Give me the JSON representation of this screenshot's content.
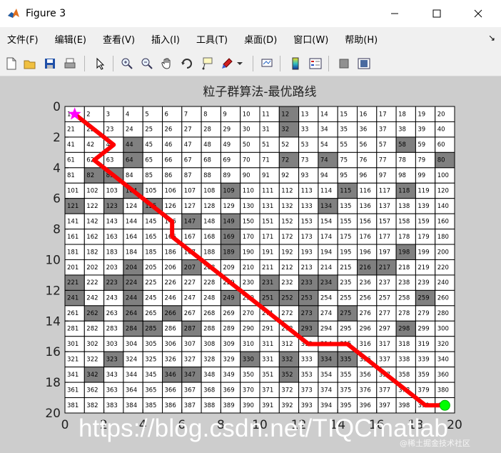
{
  "window": {
    "title": "Figure 3",
    "controls": [
      "minimize",
      "maximize",
      "close"
    ]
  },
  "menu": [
    "文件(F)",
    "编辑(E)",
    "查看(V)",
    "插入(I)",
    "工具(T)",
    "桌面(D)",
    "窗口(W)",
    "帮助(H)"
  ],
  "menu_overflow": "↘",
  "toolbar": [
    "new-figure-icon",
    "open-file-icon",
    "save-icon",
    "print-icon",
    "pointer-icon",
    "zoom-in-icon",
    "zoom-out-icon",
    "pan-hand-icon",
    "rotate-3d-icon",
    "data-cursor-icon",
    "brush-icon",
    "brush-dropdown-icon",
    "link-plot-icon",
    "colorbar-icon",
    "legend-icon",
    "hide-plot-tools-icon",
    "show-plot-tools-icon"
  ],
  "chart_data": {
    "type": "heatmap",
    "title": "粒子群算法-最优路线",
    "xlim": [
      0,
      20
    ],
    "ylim": [
      0,
      20
    ],
    "y_reversed": true,
    "xticks": [
      0,
      2,
      4,
      6,
      8,
      10,
      12,
      14,
      16,
      18,
      20
    ],
    "yticks": [
      0,
      2,
      4,
      6,
      8,
      10,
      12,
      14,
      16,
      18,
      20
    ],
    "grid_size": 20,
    "cell_labels": "sequential 1-400, row-major from top-left",
    "obstacle_cells": [
      12,
      32,
      44,
      58,
      64,
      72,
      74,
      80,
      82,
      83,
      104,
      109,
      115,
      118,
      121,
      123,
      125,
      134,
      147,
      149,
      169,
      189,
      198,
      204,
      207,
      216,
      217,
      221,
      223,
      224,
      231,
      233,
      234,
      241,
      244,
      249,
      251,
      252,
      253,
      259,
      262,
      264,
      266,
      273,
      275,
      284,
      285,
      287,
      293,
      298,
      323,
      330,
      332,
      334,
      335,
      342,
      346,
      347,
      352
    ],
    "path": {
      "x": [
        0.5,
        2.5,
        2.0,
        2.5,
        1.5,
        5.5,
        5.5,
        12.5,
        14.5,
        18.5,
        19.5
      ],
      "y": [
        0.5,
        2.5,
        3.0,
        2.5,
        3.5,
        7.5,
        8.5,
        15.5,
        15.5,
        19.5,
        19.5
      ],
      "color": "#ff0000"
    },
    "start": {
      "x": 0.5,
      "y": 0.5,
      "marker": "star",
      "color": "#ff00ff"
    },
    "goal": {
      "x": 19.5,
      "y": 19.5,
      "marker": "circle",
      "color": "#00ff00"
    },
    "obstacle_color": "#808080",
    "free_color": "#ffffff"
  },
  "watermark": {
    "url": "https://blog.csdn.net/TIQCmatlab",
    "small": "@稀土掘金技术社区"
  }
}
